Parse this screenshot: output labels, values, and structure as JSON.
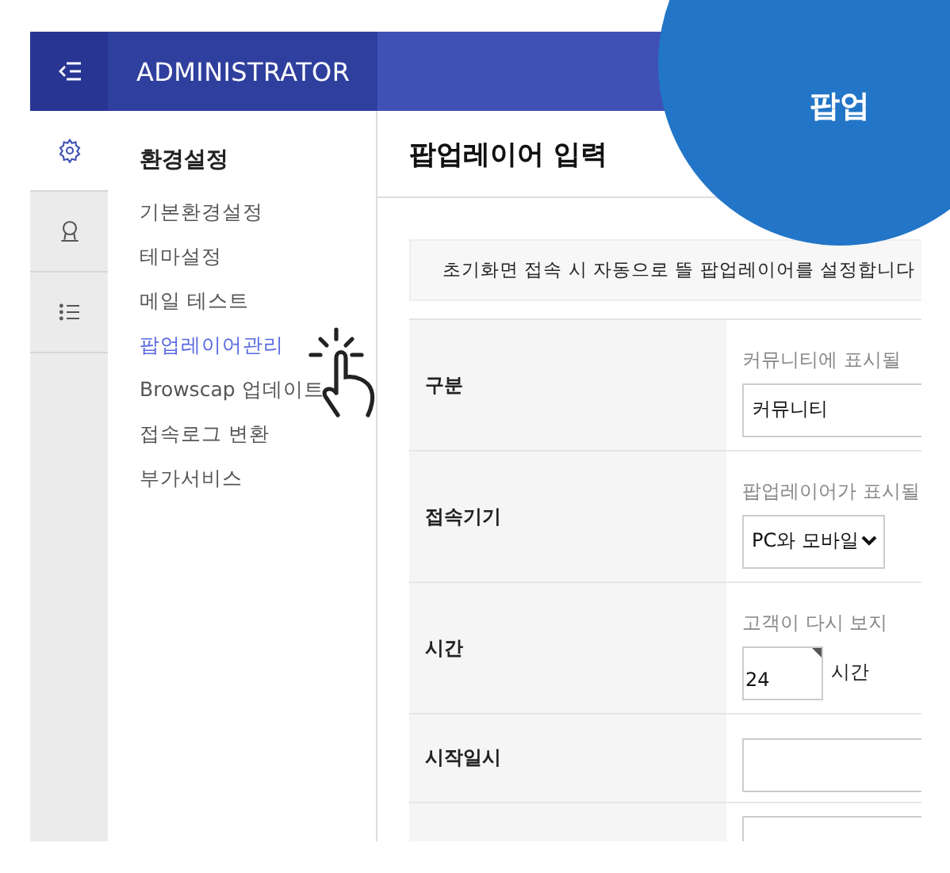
{
  "header": {
    "title": "ADMINISTRATOR"
  },
  "badge": {
    "label": "팝업"
  },
  "rail": [
    {
      "selected": true
    },
    {
      "selected": false
    },
    {
      "selected": false
    }
  ],
  "nav": {
    "heading": "환경설정",
    "items": [
      {
        "label": "기본환경설정",
        "selected": false
      },
      {
        "label": "테마설정",
        "selected": false
      },
      {
        "label": "메일 테스트",
        "selected": false
      },
      {
        "label": "팝업레이어관리",
        "selected": true
      },
      {
        "label": "Browscap 업데이트",
        "selected": false
      },
      {
        "label": "접속로그 변환",
        "selected": false
      },
      {
        "label": "부가서비스",
        "selected": false
      }
    ]
  },
  "page": {
    "title": "팝업레이어 입력",
    "notice": "초기화면 접속 시 자동으로 뜰 팝업레이어를 설정합니다"
  },
  "form": [
    {
      "label": "구분",
      "hint": "커뮤니티에 표시될",
      "kind": "select",
      "value": "커뮤니티"
    },
    {
      "label": "접속기기",
      "hint": "팝업레이어가 표시될",
      "kind": "select",
      "value": "PC와 모바일"
    },
    {
      "label": "시간",
      "hint": "고객이 다시 보지",
      "kind": "number",
      "value": "24",
      "unit": "시간"
    },
    {
      "label": "시작일시",
      "kind": "text"
    },
    {
      "kind": "text"
    }
  ]
}
